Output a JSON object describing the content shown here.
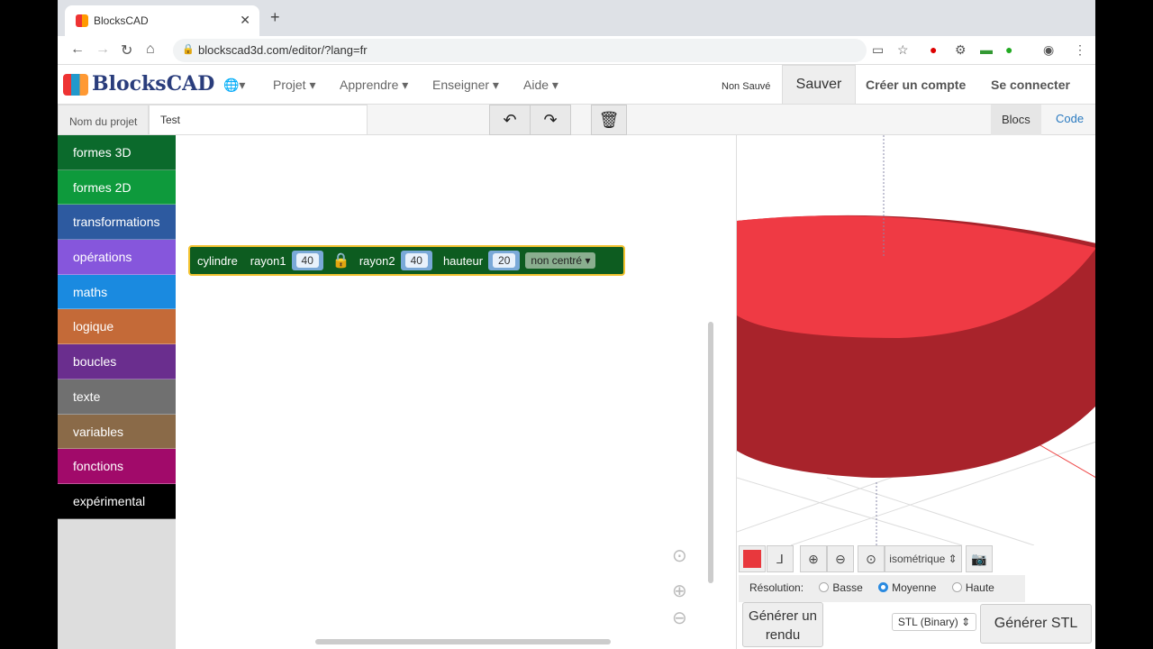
{
  "browser": {
    "tab_title": "BlocksCAD",
    "url": "blockscad3d.com/editor/?lang=fr"
  },
  "header": {
    "logo": "BlocksCAD",
    "menus": [
      "Projet",
      "Apprendre",
      "Enseigner",
      "Aide"
    ],
    "status": "Non Sauvé",
    "save": "Sauver",
    "create_account": "Créer un compte",
    "login": "Se connecter"
  },
  "project": {
    "label": "Nom du projet",
    "name": "Test",
    "view_blocks": "Blocs",
    "view_code": "Code"
  },
  "categories": [
    {
      "label": "formes 3D",
      "color": "#0b6a2c"
    },
    {
      "label": "formes 2D",
      "color": "#0e9a3c"
    },
    {
      "label": "transformations",
      "color": "#2d5aa0"
    },
    {
      "label": "opérations",
      "color": "#8656dc"
    },
    {
      "label": "maths",
      "color": "#1a8ae0"
    },
    {
      "label": "logique",
      "color": "#c46a38"
    },
    {
      "label": "boucles",
      "color": "#6a2e8e"
    },
    {
      "label": "texte",
      "color": "#707070"
    },
    {
      "label": "variables",
      "color": "#8a6a48"
    },
    {
      "label": "fonctions",
      "color": "#a10a6a"
    },
    {
      "label": "expérimental",
      "color": "#000000"
    }
  ],
  "block": {
    "name": "cylindre",
    "r1_label": "rayon1",
    "r1": "40",
    "r2_label": "rayon2",
    "r2": "40",
    "h_label": "hauteur",
    "h": "20",
    "center": "non centré"
  },
  "viewer": {
    "color": "#e8383d",
    "view": "isométrique",
    "res_label": "Résolution:",
    "res": [
      "Basse",
      "Moyenne",
      "Haute"
    ],
    "res_selected": "Moyenne",
    "render": "Générer un rendu",
    "format": "STL (Binary)",
    "gen": "Générer STL"
  }
}
